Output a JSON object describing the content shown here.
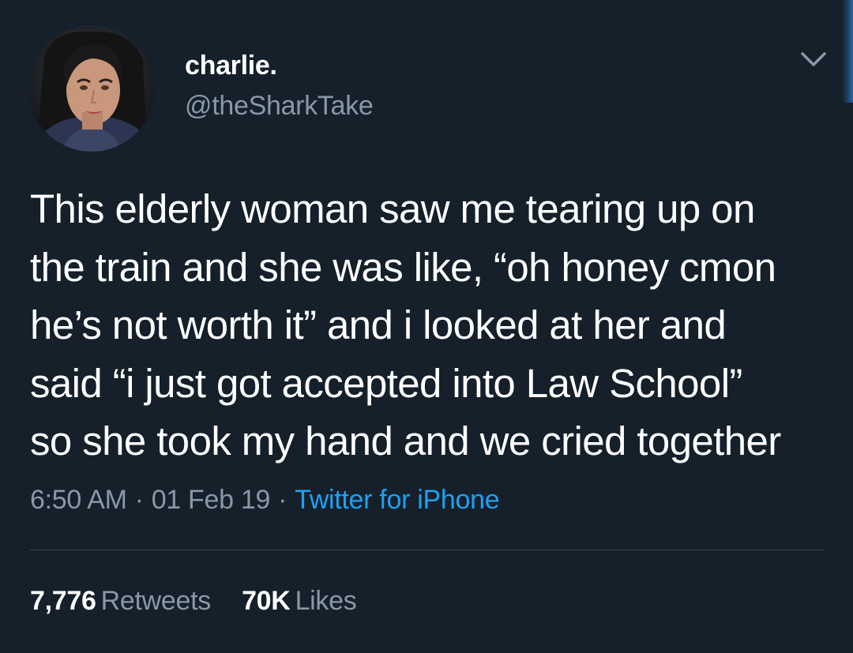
{
  "user": {
    "display_name": "charlie.",
    "handle": "@theSharkTake"
  },
  "tweet": {
    "lines": [
      "This elderly woman saw me tearing up on",
      "the train and she was like, “oh honey cmon",
      "he’s not worth it” and i looked at her and",
      "said “i just got accepted into Law School”",
      "so she took my hand and we cried together"
    ]
  },
  "meta": {
    "time": "6:50 AM",
    "separator": "·",
    "date": "01 Feb 19",
    "source": "Twitter for iPhone"
  },
  "stats": {
    "retweets_count": "7,776",
    "retweets_label": "Retweets",
    "likes_count": "70K",
    "likes_label": "Likes"
  },
  "icons": {
    "menu": "chevron-down-icon",
    "avatar": "avatar"
  },
  "colors": {
    "background": "#15202b",
    "primary_text": "#ffffff",
    "secondary_text": "#8899a6",
    "accent": "#1da1f2",
    "divider": "#38444d"
  }
}
